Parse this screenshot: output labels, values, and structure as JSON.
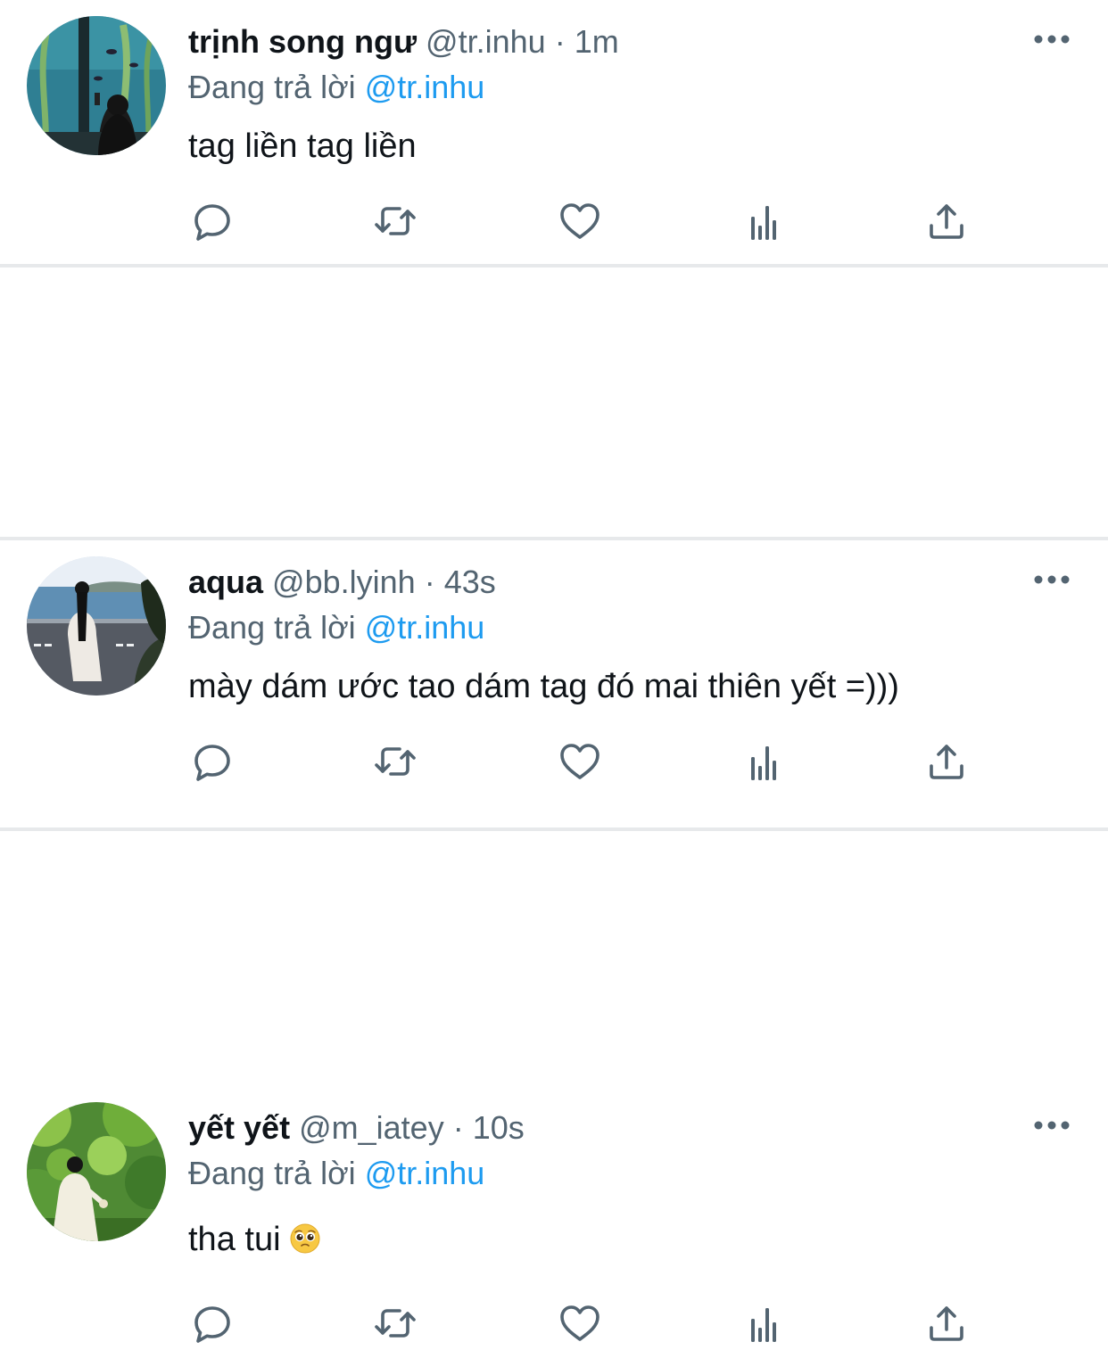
{
  "colors": {
    "text": "#0f1419",
    "secondary": "#536471",
    "link": "#1d9bf0",
    "separator": "#e7e9eb",
    "icon": "#536471"
  },
  "tweets": [
    {
      "name": "trịnh song ngư",
      "handle": "@tr.inhu",
      "separator": "·",
      "time": "1m",
      "reply_prefix": "Đang trả lời",
      "reply_to": "@tr.inhu",
      "text": "tag liền tag liền",
      "avatar_icon": "avatar-aquarium-photo"
    },
    {
      "name": "aqua",
      "handle": "@bb.lyinh",
      "separator": "·",
      "time": "43s",
      "reply_prefix": "Đang trả lời",
      "reply_to": "@tr.inhu",
      "text": "mày dám ước tao dám tag đó mai thiên yết =)))",
      "avatar_icon": "avatar-seaside-photo"
    },
    {
      "name": "yết yết",
      "handle": "@m_iatey",
      "separator": "·",
      "time": "10s",
      "reply_prefix": "Đang trả lời",
      "reply_to": "@tr.inhu",
      "text": "tha tui",
      "emoji": "🥺",
      "avatar_icon": "avatar-forest-photo"
    }
  ],
  "action_icons": [
    "reply-icon",
    "retweet-icon",
    "like-icon",
    "analytics-icon",
    "share-icon"
  ]
}
